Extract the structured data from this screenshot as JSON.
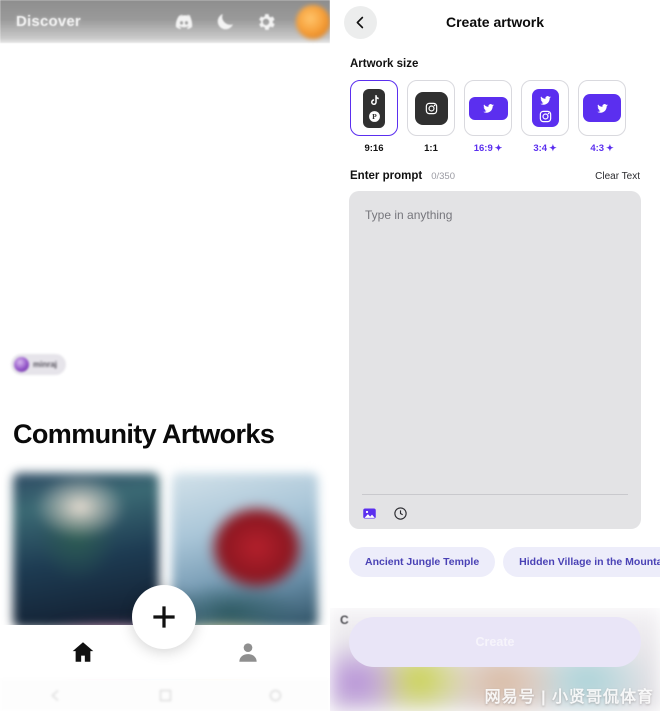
{
  "left_app": {
    "topbar": {
      "title": "Discover",
      "icons": [
        {
          "name": "discord-icon"
        },
        {
          "name": "moon-icon"
        },
        {
          "name": "gear-icon"
        }
      ],
      "avatar_name": "user-avatar"
    },
    "user_pill": {
      "name": "minraj"
    },
    "community": {
      "heading": "Community Artworks"
    },
    "artworks": [
      {
        "name": "artwork-thumbnail-1"
      },
      {
        "name": "artwork-thumbnail-2"
      }
    ],
    "bottom_nav": {
      "items": [
        {
          "name": "nav-home",
          "icon": "home-icon",
          "active": true
        },
        {
          "name": "nav-profile",
          "icon": "person-icon",
          "active": false
        }
      ],
      "fab": {
        "icon": "plus-icon",
        "label": "+"
      }
    },
    "system_nav": [
      {
        "name": "sys-back-icon"
      },
      {
        "name": "sys-home-icon"
      },
      {
        "name": "sys-recents-icon"
      }
    ]
  },
  "right_app": {
    "header": {
      "back_icon": "chevron-left-icon",
      "title": "Create artwork"
    },
    "artwork_size": {
      "label": "Artwork size",
      "options": [
        {
          "ratio": "9:16",
          "pro": false,
          "selected": true,
          "fill": "dark",
          "icons": [
            "tiktok-icon",
            "pinterest-icon"
          ]
        },
        {
          "ratio": "1:1",
          "pro": false,
          "selected": false,
          "fill": "dark",
          "icons": [
            "instagram-icon"
          ]
        },
        {
          "ratio": "16:9",
          "pro": true,
          "selected": false,
          "fill": "purple",
          "icons": [
            "twitter-icon"
          ]
        },
        {
          "ratio": "3:4",
          "pro": true,
          "selected": false,
          "fill": "purple",
          "icons": [
            "twitter-icon",
            "instagram-icon"
          ]
        },
        {
          "ratio": "4:3",
          "pro": true,
          "selected": false,
          "fill": "purple",
          "icons": [
            "twitter-icon"
          ]
        }
      ],
      "pro_marker": "✦"
    },
    "prompt": {
      "label": "Enter prompt",
      "counter": "0/350",
      "clear_label": "Clear Text",
      "placeholder": "Type in anything",
      "value": "",
      "tools": [
        {
          "name": "image-upload-icon"
        },
        {
          "name": "history-icon"
        }
      ]
    },
    "suggestions": [
      {
        "label": "Ancient Jungle Temple"
      },
      {
        "label": "Hidden Village in the Mountains"
      }
    ],
    "occluded_text": "C",
    "create_button": {
      "label": "Create",
      "disabled": true
    },
    "watermark": "网易号 | 小贤哥侃体育"
  },
  "colors": {
    "accent_purple": "#5B2FEF",
    "chip_bg": "#EDEDFA",
    "chip_text": "#4A42B5",
    "prompt_bg": "#E3E3E5",
    "card_dark": "#303030"
  }
}
